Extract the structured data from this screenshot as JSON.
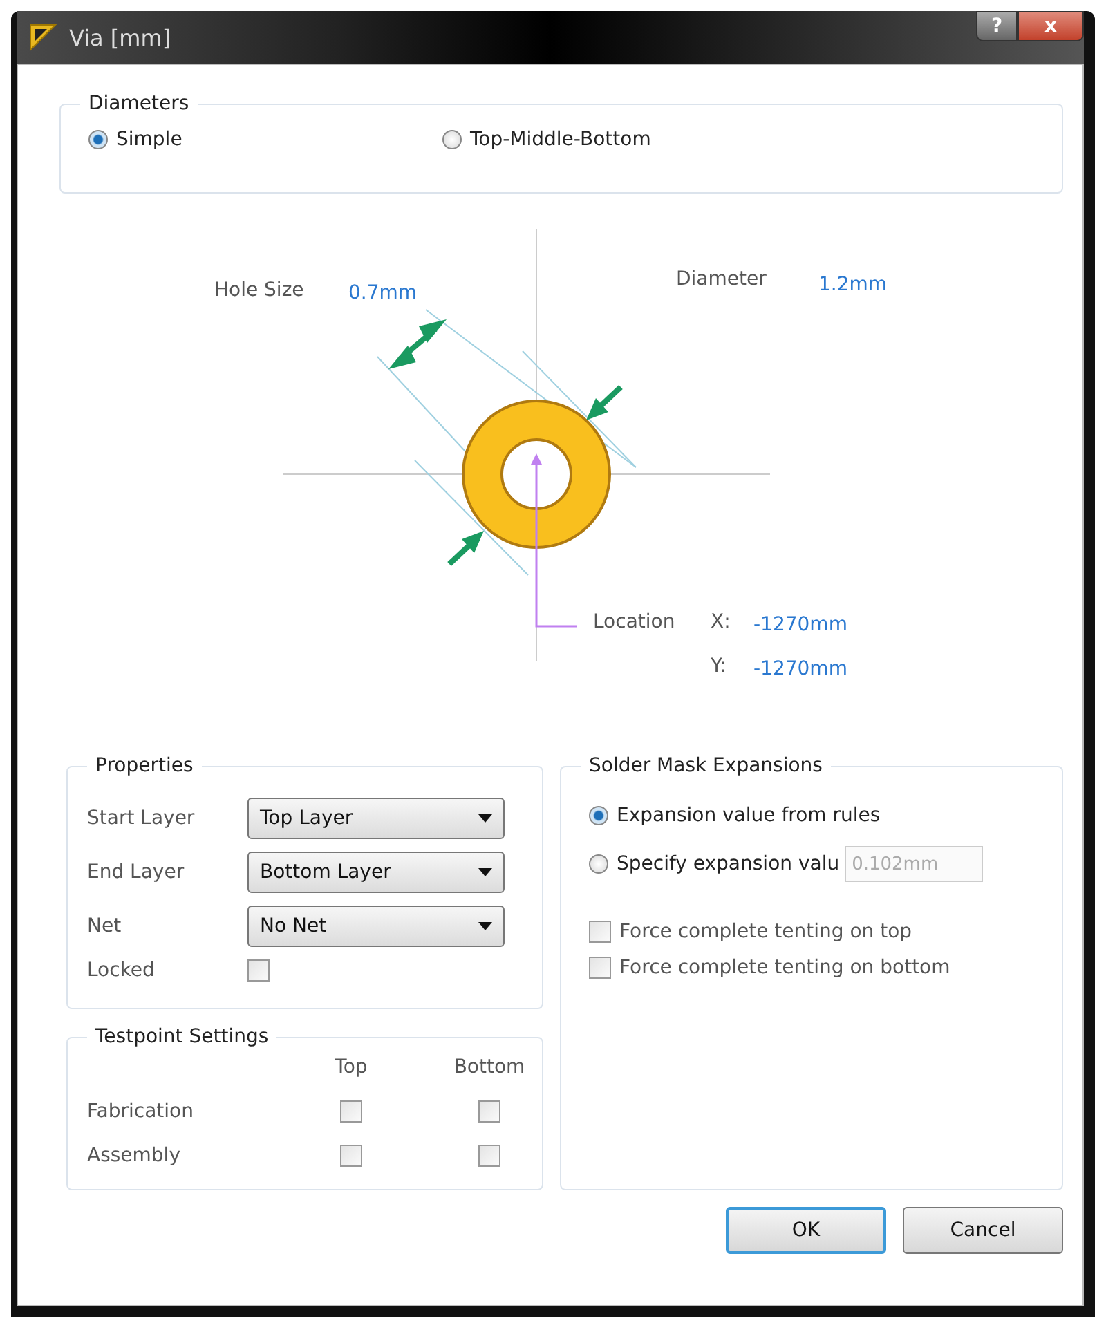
{
  "window": {
    "title": "Via [mm]",
    "title_buttons": [
      {
        "kind": "help",
        "label": "?"
      },
      {
        "kind": "close",
        "label": "x"
      }
    ]
  },
  "diameters": {
    "title": "Diameters",
    "options": [
      {
        "label": "Simple",
        "selected": true
      },
      {
        "label": "Top-Middle-Bottom",
        "selected": false
      }
    ]
  },
  "diagram": {
    "hole_size": {
      "label": "Hole Size",
      "value": "0.7mm"
    },
    "diameter": {
      "label": "Diameter",
      "value": "1.2mm"
    },
    "location": {
      "label": "Location",
      "x_label": "X:",
      "x_value": "-1270mm",
      "y_label": "Y:",
      "y_value": "-1270mm"
    }
  },
  "properties": {
    "title": "Properties",
    "fields": [
      {
        "label": "Start Layer",
        "value": "Top Layer"
      },
      {
        "label": "End Layer",
        "value": "Bottom Layer"
      },
      {
        "label": "Net",
        "value": "No Net"
      }
    ],
    "locked": {
      "label": "Locked",
      "checked": false
    }
  },
  "testpoint": {
    "title": "Testpoint Settings",
    "columns": [
      "Top",
      "Bottom"
    ],
    "rows": [
      {
        "label": "Fabrication",
        "top": false,
        "bottom": false
      },
      {
        "label": "Assembly",
        "top": false,
        "bottom": false
      }
    ]
  },
  "solder_mask": {
    "title": "Solder Mask Expansions",
    "options": [
      {
        "label": "Expansion value from rules",
        "selected": true
      },
      {
        "label": "Specify expansion valu",
        "selected": false,
        "value": "0.102mm"
      }
    ],
    "checks": [
      {
        "label": "Force complete tenting on top",
        "checked": false
      },
      {
        "label": "Force complete tenting on bottom",
        "checked": false
      }
    ]
  },
  "buttons": [
    {
      "label": "OK",
      "default": true
    },
    {
      "label": "Cancel",
      "default": false
    }
  ]
}
